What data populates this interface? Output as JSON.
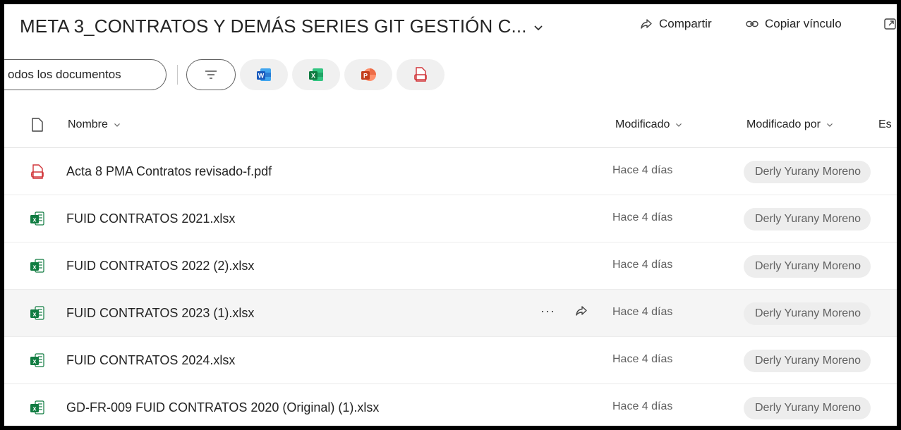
{
  "header": {
    "title": "META 3_CONTRATOS Y DEMÁS SERIES GIT GESTIÓN C...",
    "share_label": "Compartir",
    "copy_link_label": "Copiar vínculo"
  },
  "toolbar": {
    "view_label": "odos los documentos",
    "apps": [
      "word-icon",
      "excel-icon",
      "powerpoint-icon",
      "pdf-icon"
    ]
  },
  "columns": {
    "name": "Nombre",
    "modified": "Modificado",
    "modified_by": "Modificado por",
    "status_partial": "Es"
  },
  "files": [
    {
      "name": "Acta 8 PMA Contratos revisado-f.pdf",
      "type": "pdf",
      "modified": "Hace 4 días",
      "modified_by": "Derly Yurany Moreno"
    },
    {
      "name": "FUID CONTRATOS 2021.xlsx",
      "type": "xlsx",
      "modified": "Hace 4 días",
      "modified_by": "Derly Yurany Moreno"
    },
    {
      "name": "FUID CONTRATOS 2022 (2).xlsx",
      "type": "xlsx",
      "modified": "Hace 4 días",
      "modified_by": "Derly Yurany Moreno"
    },
    {
      "name": "FUID CONTRATOS 2023 (1).xlsx",
      "type": "xlsx",
      "modified": "Hace 4 días",
      "modified_by": "Derly Yurany Moreno",
      "hover": true,
      "more_label": "···"
    },
    {
      "name": "FUID CONTRATOS 2024.xlsx",
      "type": "xlsx",
      "modified": "Hace 4 días",
      "modified_by": "Derly Yurany Moreno"
    },
    {
      "name": "GD-FR-009 FUID CONTRATOS 2020 (Original) (1).xlsx",
      "type": "xlsx",
      "modified": "Hace 4 días",
      "modified_by": "Derly Yurany Moreno"
    }
  ],
  "colors": {
    "word": "#185abd",
    "excel": "#107c41",
    "powerpoint": "#c43e1c",
    "pdf": "#d13438"
  }
}
